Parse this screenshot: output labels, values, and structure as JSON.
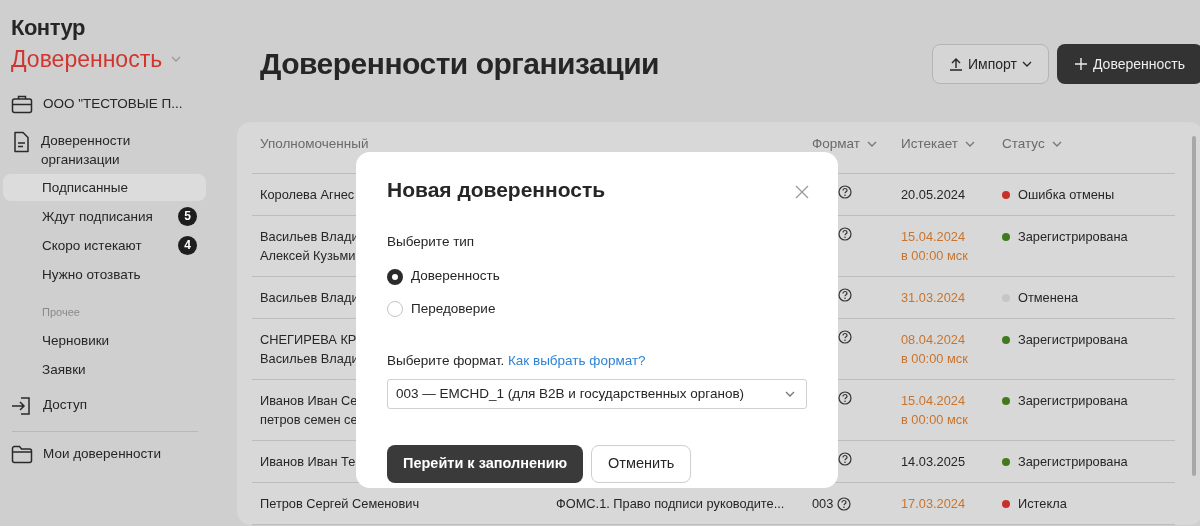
{
  "logo": {
    "brand": "Контур",
    "product": "Доверенность"
  },
  "sidebar": {
    "organization": "ООО \"ТЕСТОВЫЕ П...",
    "org_section": {
      "label": "Доверенности организации",
      "children": [
        {
          "label": "Подписанные",
          "selected": true
        },
        {
          "label": "Ждут подписания",
          "selected": false,
          "count": "5"
        },
        {
          "label": "Скоро истекают",
          "selected": false,
          "count": "4"
        },
        {
          "label": "Нужно отозвать",
          "selected": false
        }
      ]
    },
    "other": {
      "caption": "Прочее",
      "items": [
        {
          "label": "Черновики",
          "selected": false
        },
        {
          "label": "Заявки",
          "selected": false
        }
      ]
    },
    "access": "Доступ",
    "my": "Мои доверенности"
  },
  "header": {
    "title": "Доверенности организации",
    "import_button": "Импорт",
    "create_button": "Доверенность"
  },
  "table": {
    "columns": [
      {
        "label": "Уполномоченный"
      },
      {},
      {
        "label": "Формат"
      },
      {
        "label": "Истекает"
      },
      {
        "label": "Статус"
      }
    ],
    "rows": [
      {
        "authorized": [
          "Королева Агнес"
        ],
        "expires": {
          "date": "20.05.2024",
          "warning": false
        },
        "status": {
          "label": "Ошибка отмены",
          "color": "#c8312b"
        }
      },
      {
        "authorized": [
          "Васильев Влади",
          "Алексей Кузьми"
        ],
        "expires": {
          "date": "15.04.2024",
          "time": "в 00:00 мск",
          "warning": true
        },
        "status": {
          "label": "Зарегистрирована",
          "color": "#3f7a1e"
        }
      },
      {
        "authorized": [
          "Васильев Влади"
        ],
        "expires": {
          "date": "31.03.2024",
          "warning": true
        },
        "status": {
          "label": "Отменена",
          "color": "#c6c6c6"
        }
      },
      {
        "authorized": [
          "СНЕГИРЕВА КР",
          "Васильев Влади"
        ],
        "expires": {
          "date": "08.04.2024",
          "time": "в 00:00 мск",
          "warning": true
        },
        "status": {
          "label": "Зарегистрирована",
          "color": "#3f7a1e"
        }
      },
      {
        "authorized": [
          "Иванов Иван Се",
          "петров семен се"
        ],
        "expires": {
          "date": "15.04.2024",
          "time": "в 00:00 мск",
          "warning": true
        },
        "status": {
          "label": "Зарегистрирована",
          "color": "#3f7a1e"
        }
      },
      {
        "authorized": [
          "Иванов Иван Те"
        ],
        "expires": {
          "date": "14.03.2025",
          "warning": false
        },
        "status": {
          "label": "Зарегистрирована",
          "color": "#3f7a1e"
        }
      },
      {
        "authorized": [
          "Петров Сергей Семенович"
        ],
        "power": "ФОМС.1. Право подписи руководите...",
        "format": "003",
        "expires": {
          "date": "17.03.2024",
          "warning": true
        },
        "status": {
          "label": "Истекла",
          "color": "#c8312b"
        }
      }
    ]
  },
  "modal": {
    "title": "Новая доверенность",
    "type_label": "Выберите тип",
    "options": [
      {
        "label": "Доверенность",
        "selected": true
      },
      {
        "label": "Передоверие",
        "selected": false
      }
    ],
    "format_label": "Выберите формат.",
    "format_link": "Как выбрать формат?",
    "format_value": "003 — EMCHD_1 (для B2B и государственных органов)",
    "submit_button": "Перейти к заполнению",
    "cancel_button": "Отменить"
  }
}
